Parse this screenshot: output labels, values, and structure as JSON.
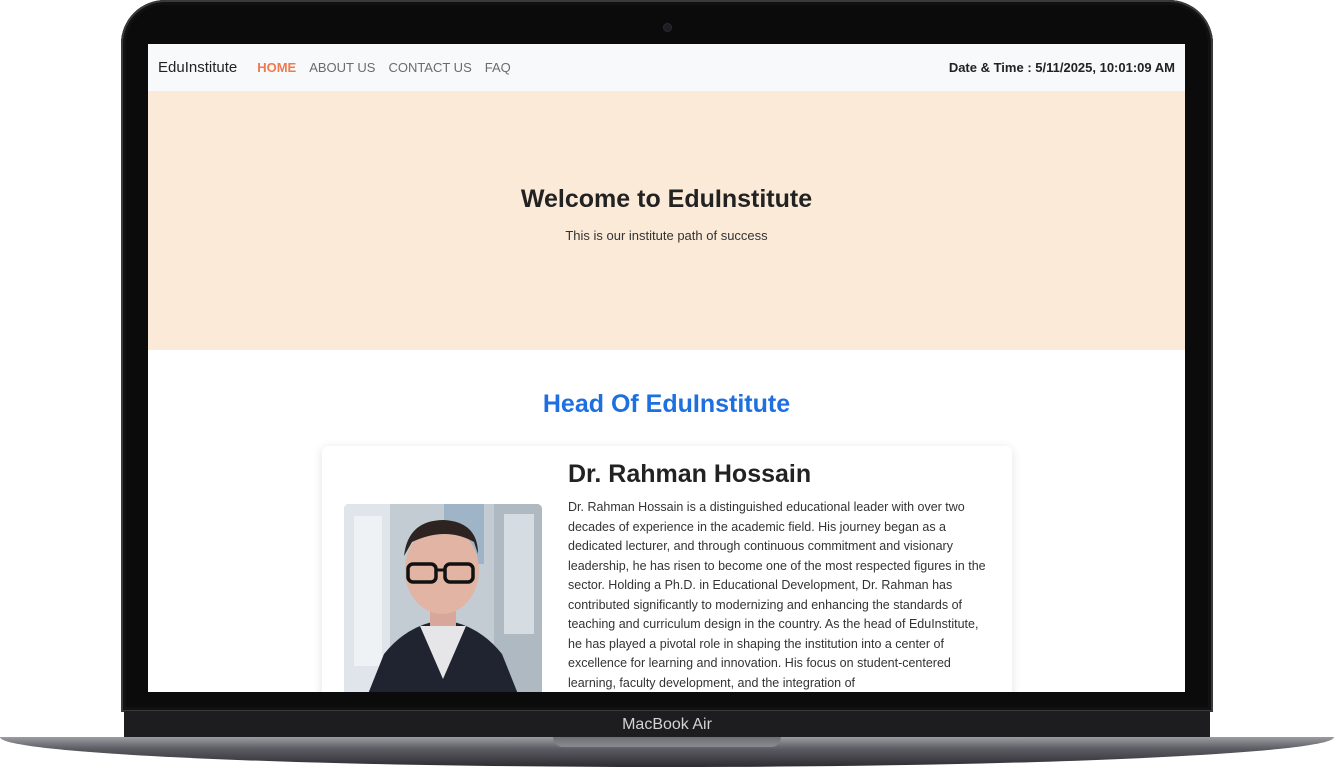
{
  "navbar": {
    "brand": "EduInstitute",
    "links": [
      "HOME",
      "ABOUT US",
      "CONTACT US",
      "FAQ"
    ],
    "active_link": "HOME",
    "datetime": "Date & Time : 5/11/2025, 10:01:09 AM"
  },
  "hero": {
    "title": "Welcome to EduInstitute",
    "subtitle": "This is our institute path of success"
  },
  "head_section": {
    "title": "Head Of EduInstitute",
    "name": "Dr. Rahman Hossain",
    "bio": "Dr. Rahman Hossain is a distinguished educational leader with over two decades of experience in the academic field. His journey began as a dedicated lecturer, and through continuous commitment and visionary leadership, he has risen to become one of the most respected figures in the sector. Holding a Ph.D. in Educational Development, Dr. Rahman has contributed significantly to modernizing and enhancing the standards of teaching and curriculum design in the country. As the head of EduInstitute, he has played a pivotal role in shaping the institution into a center of excellence for learning and innovation. His focus on student-centered learning, faculty development, and the integration of"
  },
  "device": {
    "label": "MacBook Air"
  },
  "colors": {
    "accent_active": "#ee7a4f",
    "section_title": "#1e6fe0",
    "hero_bg": "#fbead7"
  }
}
